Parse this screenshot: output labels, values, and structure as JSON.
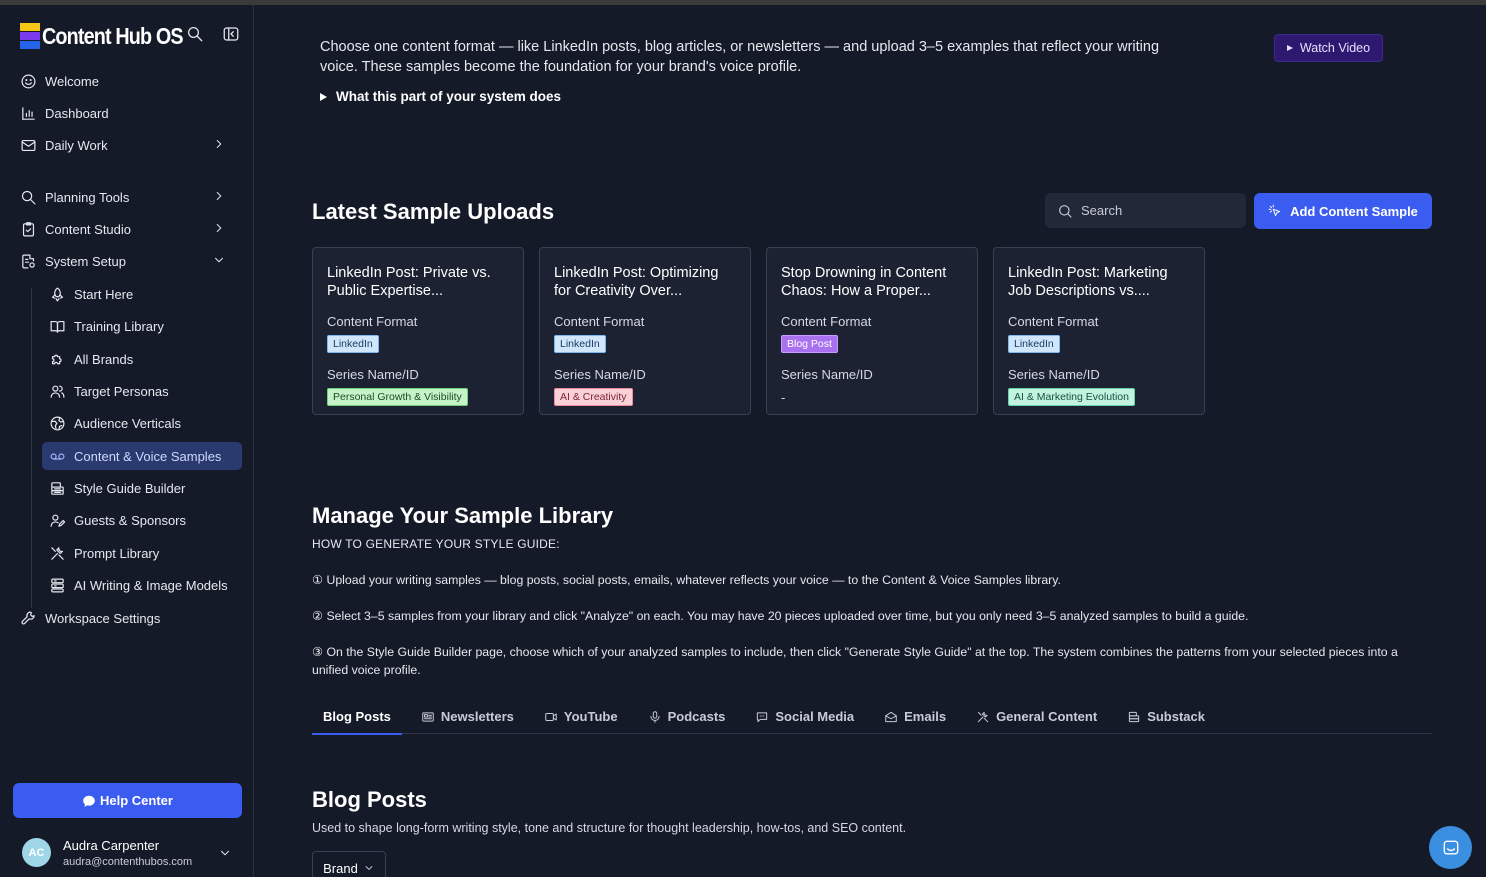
{
  "app": {
    "brand": "Content Hub OS"
  },
  "sidebar": {
    "items": [
      {
        "label": "Welcome"
      },
      {
        "label": "Dashboard"
      },
      {
        "label": "Daily Work"
      },
      {
        "label": "Planning Tools"
      },
      {
        "label": "Content Studio"
      },
      {
        "label": "System Setup"
      }
    ],
    "sub_items": [
      {
        "label": "Start Here"
      },
      {
        "label": "Training Library"
      },
      {
        "label": "All Brands"
      },
      {
        "label": "Target Personas"
      },
      {
        "label": "Audience Verticals"
      },
      {
        "label": "Content & Voice Samples"
      },
      {
        "label": "Style Guide Builder"
      },
      {
        "label": "Guests & Sponsors"
      },
      {
        "label": "Prompt Library"
      },
      {
        "label": "AI Writing & Image Models"
      }
    ],
    "workspace": "Workspace Settings",
    "help": "Help Center",
    "user": {
      "initials": "AC",
      "name": "Audra Carpenter",
      "email": "audra@contenthubos.com"
    }
  },
  "intro": {
    "text": "Choose one content format — like LinkedIn posts, blog articles, or newsletters — and upload 3–5 examples that reflect your writing voice. These samples become the foundation for your brand's voice profile.",
    "watch_label": "Watch Video",
    "disclosure": "What this part of your system does"
  },
  "latest": {
    "title": "Latest Sample Uploads",
    "search_placeholder": "Search",
    "add_label": "Add Content Sample",
    "cards": [
      {
        "title": "LinkedIn Post: Private vs. Public Expertise...",
        "format_label": "Content Format",
        "format": "LinkedIn",
        "series_label": "Series Name/ID",
        "series": "Personal Growth & Visibility"
      },
      {
        "title": "LinkedIn Post: Optimizing for Creativity Over...",
        "format_label": "Content Format",
        "format": "LinkedIn",
        "series_label": "Series Name/ID",
        "series": "AI & Creativity"
      },
      {
        "title": "Stop Drowning in Content Chaos: How a Proper...",
        "format_label": "Content Format",
        "format": "Blog Post",
        "series_label": "Series Name/ID",
        "series": "-"
      },
      {
        "title": "LinkedIn Post: Marketing Job Descriptions vs....",
        "format_label": "Content Format",
        "format": "LinkedIn",
        "series_label": "Series Name/ID",
        "series": "AI & Marketing Evolution"
      }
    ]
  },
  "library": {
    "title": "Manage Your Sample Library",
    "howto": "HOW TO GENERATE YOUR STYLE GUIDE:",
    "steps": [
      "① Upload your writing samples — blog posts, social posts, emails, whatever reflects your voice — to the Content & Voice Samples library.",
      "② Select 3–5 samples from your library and click \"Analyze\" on each. You may have 20 pieces uploaded over time, but you only need 3–5 analyzed samples to build a guide.",
      "③ On the Style Guide Builder page, choose which of your analyzed samples to include, then click \"Generate Style Guide\" at the top. The system combines the patterns from your selected pieces into a unified voice profile."
    ],
    "tabs": [
      {
        "label": "Blog Posts"
      },
      {
        "label": "Newsletters"
      },
      {
        "label": "YouTube"
      },
      {
        "label": "Podcasts"
      },
      {
        "label": "Social Media"
      },
      {
        "label": "Emails"
      },
      {
        "label": "General Content"
      },
      {
        "label": "Substack"
      }
    ]
  },
  "section": {
    "title": "Blog Posts",
    "description": "Used to shape long-form writing style, tone and structure for thought leadership, how-tos, and SEO content.",
    "brand_filter": "Brand"
  }
}
